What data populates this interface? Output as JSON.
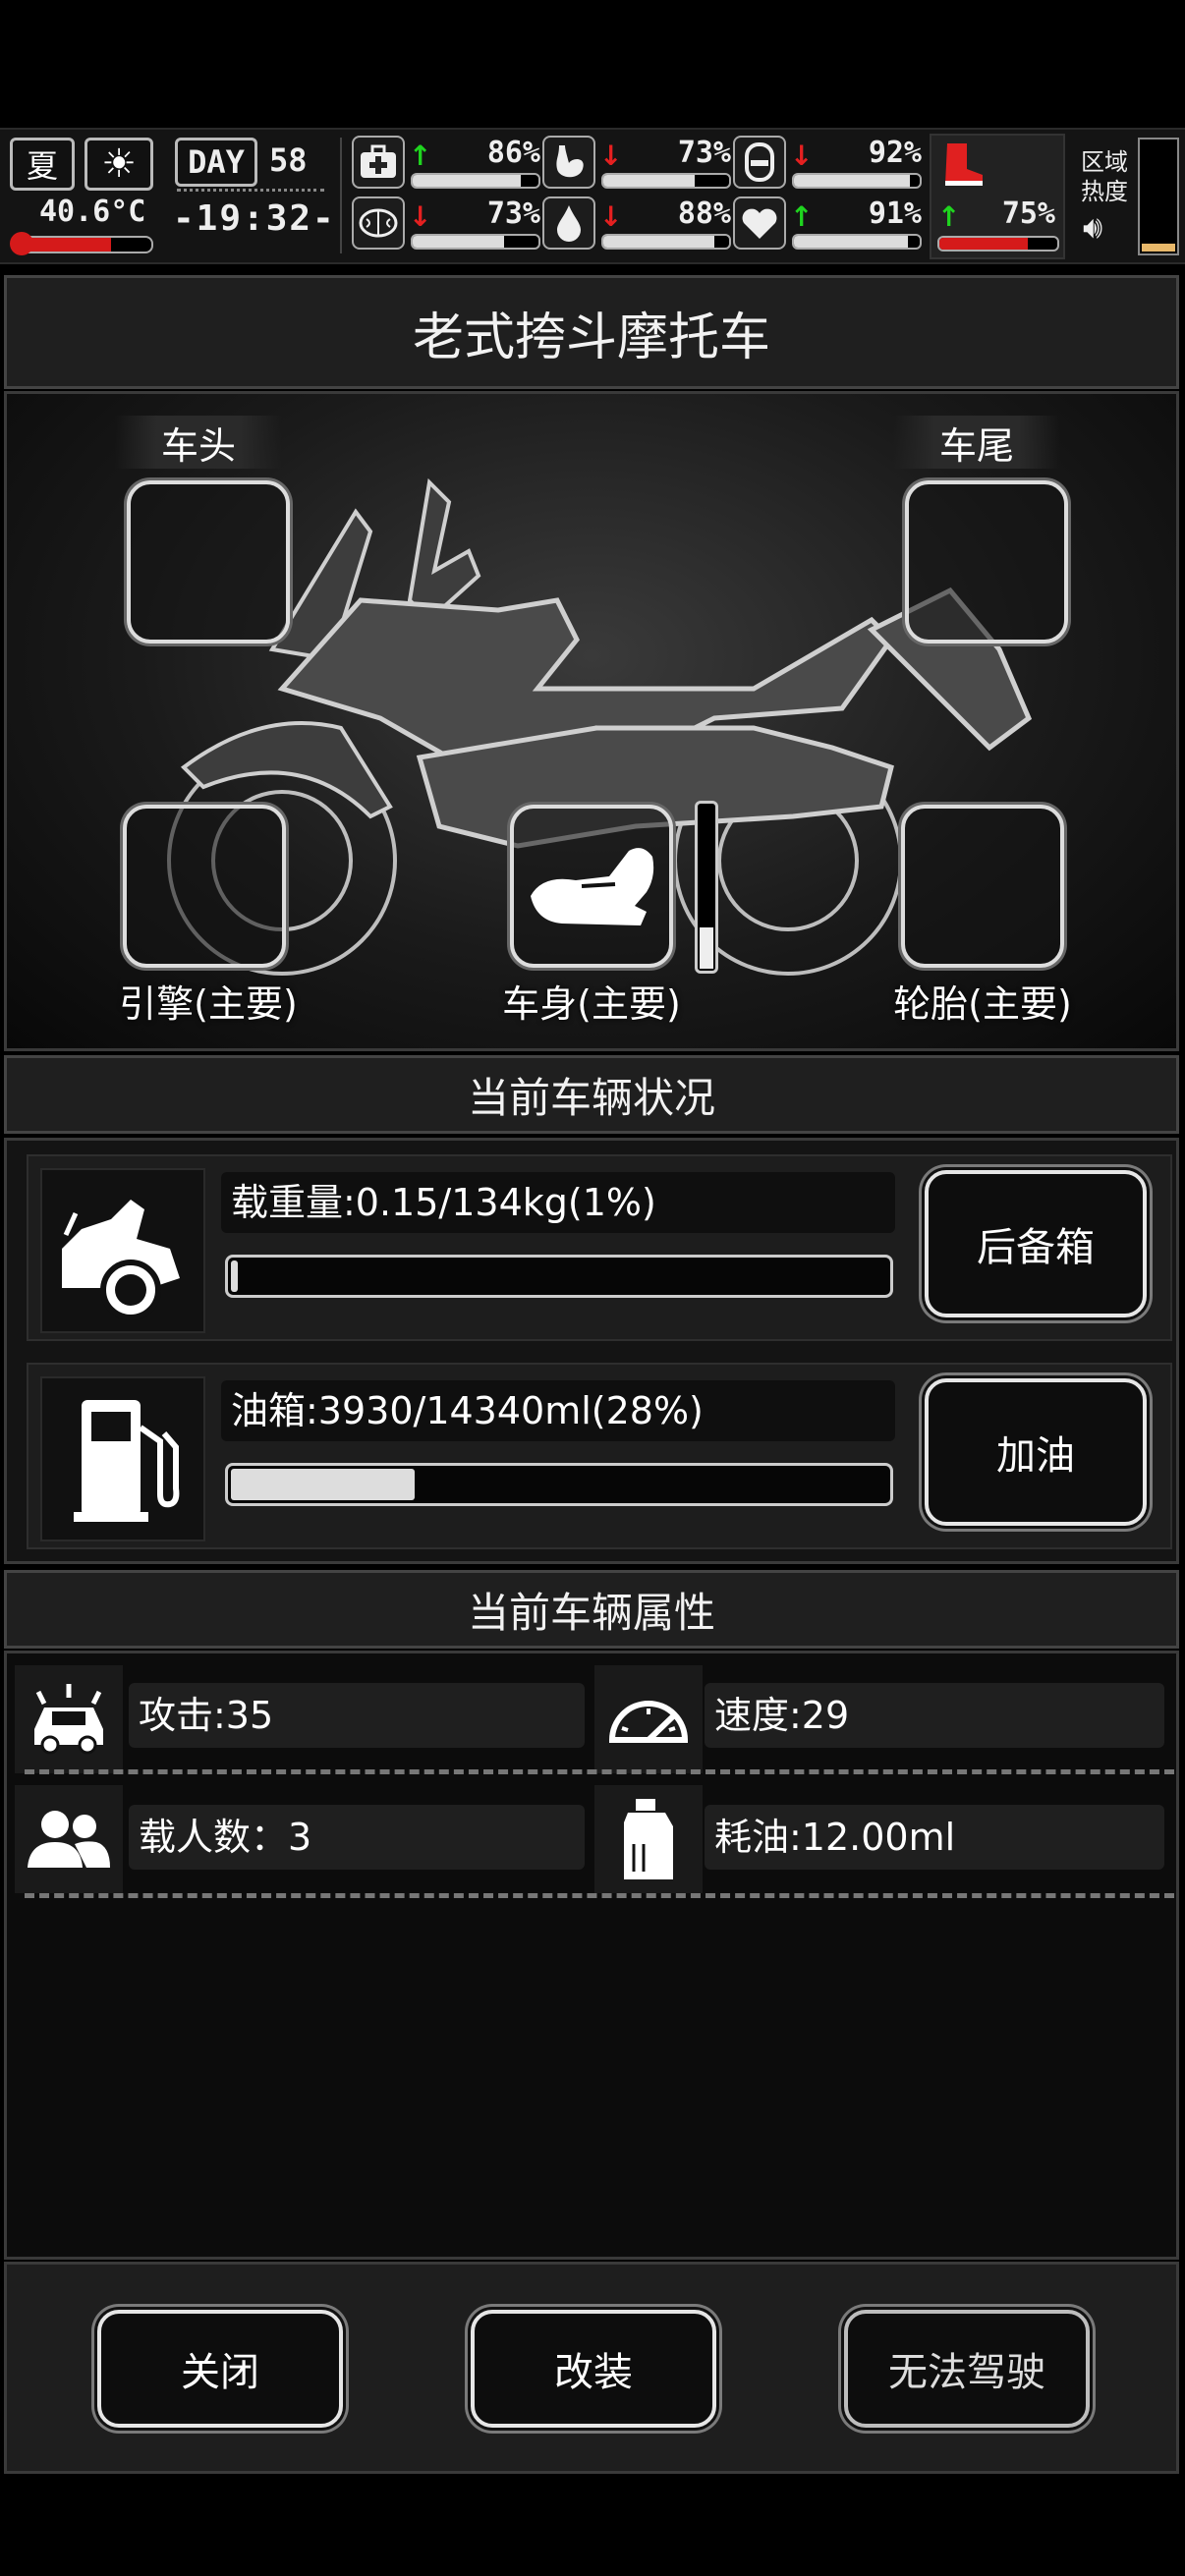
{
  "hud": {
    "season": "夏",
    "temperature": "40.6°C",
    "day_label": "DAY",
    "day_number": "58",
    "clock": "-19:32-",
    "stats": [
      {
        "icon": "medkit-icon",
        "trend": "up",
        "percent": "86%",
        "value": 0.86
      },
      {
        "icon": "stomach-icon",
        "trend": "down",
        "percent": "73%",
        "value": 0.73
      },
      {
        "icon": "bladder-icon",
        "trend": "down",
        "percent": "92%",
        "value": 0.92
      },
      {
        "icon": "brain-icon",
        "trend": "down",
        "percent": "73%",
        "value": 0.73
      },
      {
        "icon": "water-drop-icon",
        "trend": "down",
        "percent": "88%",
        "value": 0.88
      },
      {
        "icon": "heart-icon",
        "trend": "up",
        "percent": "91%",
        "value": 0.91
      }
    ],
    "stamina": {
      "icon": "boot-icon",
      "trend": "up",
      "percent": "75%",
      "value": 0.75
    },
    "zone_heat_label": "区域热度",
    "temperature_level": 0.7
  },
  "vehicle": {
    "title": "老式挎斗摩托车",
    "slots": {
      "head": "车头",
      "tail": "车尾",
      "engine": "引擎(主要)",
      "body": "车身(主要)",
      "tire": "轮胎(主要)"
    }
  },
  "status": {
    "title": "当前车辆状况",
    "load_label": "载重量:0.15/134kg(1%)",
    "load_value": 0.01,
    "trunk_button": "后备箱",
    "fuel_label": "油箱:3930/14340ml(28%)",
    "fuel_value": 0.28,
    "refuel_button": "加油"
  },
  "attributes": {
    "title": "当前车辆属性",
    "attack": "攻击:35",
    "speed": "速度:29",
    "passengers": "载人数：3",
    "fuel_use": "耗油:12.00ml"
  },
  "footer": {
    "close": "关闭",
    "modify": "改装",
    "drive": "无法驾驶"
  }
}
